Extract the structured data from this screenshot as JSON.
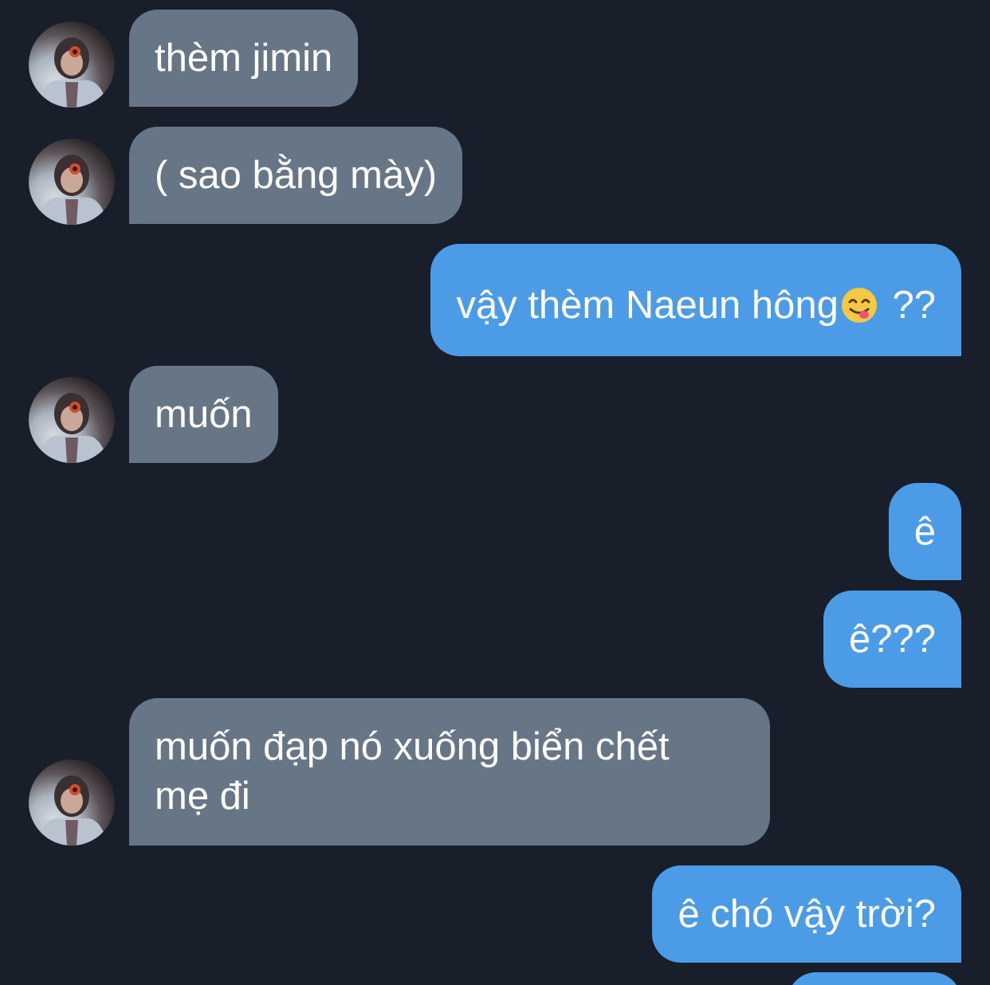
{
  "messages": [
    {
      "side": "in",
      "text": "thèm jimin"
    },
    {
      "side": "in",
      "text": "( sao bằng mày)"
    },
    {
      "side": "out",
      "text_before": "vậy thèm Naeun hông",
      "emoji": "yum-face-emoji",
      "text_after": " ??"
    },
    {
      "side": "in",
      "text": "muốn"
    },
    {
      "side": "out",
      "text": "ê"
    },
    {
      "side": "out",
      "text": "ê???"
    },
    {
      "side": "in",
      "line1": "muốn đạp nó xuống biển chết",
      "line2": "mẹ đi"
    },
    {
      "side": "out",
      "text": "ê chó vậy trời?"
    }
  ],
  "colors": {
    "background": "#181f2a",
    "incoming_bubble": "#677686",
    "outgoing_bubble": "#4b9be6",
    "text": "#ffffff"
  },
  "icons": {
    "avatar": "contact-avatar-photo",
    "emoji": "yum-face-emoji"
  }
}
